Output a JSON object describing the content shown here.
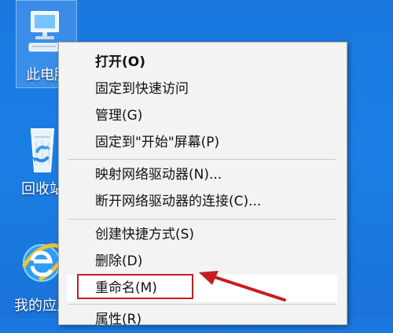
{
  "desktop": {
    "icons": [
      {
        "label": "此电脑",
        "name": "this-pc"
      },
      {
        "label": "回收站",
        "name": "recycle-bin"
      },
      {
        "label": "我的应用",
        "name": "internet-explorer"
      }
    ]
  },
  "context_menu": {
    "items": [
      {
        "label": "打开(O)",
        "bold": true
      },
      {
        "label": "固定到快速访问"
      },
      {
        "label": "管理(G)"
      },
      {
        "label": "固定到\"开始\"屏幕(P)"
      },
      {
        "label": "映射网络驱动器(N)..."
      },
      {
        "label": "断开网络驱动器的连接(C)..."
      },
      {
        "label": "创建快捷方式(S)"
      },
      {
        "label": "删除(D)"
      },
      {
        "label": "重命名(M)"
      },
      {
        "label": "属性(R)"
      }
    ]
  },
  "colors": {
    "desktop_blue": "#1b7ee5",
    "menu_background": "#f3f3f3",
    "highlight_red": "#c61d22"
  },
  "icons": {
    "computer": "computer-icon",
    "recycle": "recycle-bin-icon",
    "browser": "internet-explorer-icon",
    "arrow": "annotation-arrow-icon"
  }
}
